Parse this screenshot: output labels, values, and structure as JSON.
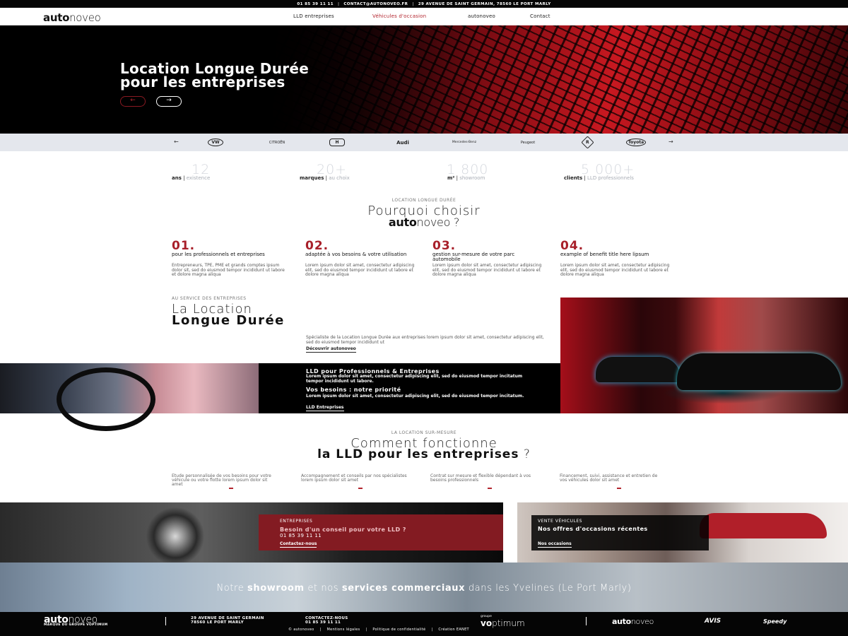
{
  "topbar": {
    "phone": "01 85 39 11 11",
    "email": "CONTACT@AUTONOVEO.FR",
    "address": "29 AVENUE DE SAINT GERMAIN, 78560 LE PORT MARLY"
  },
  "nav": {
    "logo_bold": "auto",
    "logo_light": "noveo",
    "links": [
      "LLD entreprises",
      "Véhicules d'occasion",
      "autonoveo",
      "Contact"
    ],
    "active_index": 1
  },
  "hero": {
    "title_line1": "Location Longue Durée",
    "title_line2": "pour les entreprises",
    "prev_icon": "←",
    "next_icon": "→"
  },
  "brands": {
    "prev_icon": "←",
    "next_icon": "→",
    "items": [
      "VW",
      "CITROËN",
      "H",
      "Audi",
      "Mercedes-Benz",
      "Peugeot",
      "R",
      "Toyota"
    ]
  },
  "stats": [
    {
      "value": "12",
      "label_bold": "ans",
      "label_light": "existence"
    },
    {
      "value": "20+",
      "label_bold": "marques",
      "label_light": "au choix"
    },
    {
      "value": "1 800",
      "label_bold": "m²",
      "label_light": "showroom"
    },
    {
      "value": "5 000+",
      "label_bold": "clients",
      "label_light": "LLD professionnels"
    }
  ],
  "why": {
    "kicker": "LOCATION LONGUE DURÉE",
    "title_line1": "Pourquoi choisir",
    "title_logo_bold": "auto",
    "title_logo_light": "noveo",
    "title_suffix": " ?",
    "features": [
      {
        "num": "01.",
        "title": "pour les professionnels et entreprises",
        "text": "Entrepreneurs, TPE, PME et grands comptes ipsum dolor sit, sed do eiusmod tempor incididunt ut labore et dolore magna aliqua"
      },
      {
        "num": "02.",
        "title": "adaptée à vos besoins & votre utilisation",
        "text": "Lorem ipsum dolor sit amet, consectetur adipiscing elit, sed do eiusmod tempor incididunt ut labore et dolore magna aliqua"
      },
      {
        "num": "03.",
        "title": "gestion sur-mesure de votre parc automobile",
        "text": "Lorem ipsum dolor sit amet, consectetur adipiscing elit, sed do eiusmod tempor incididunt ut labore et dolore magna aliqua"
      },
      {
        "num": "04.",
        "title": "example of benefit title here lipsum",
        "text": "Lorem ipsum dolor sit amet, consectetur adipiscing elit, sed do eiusmod tempor incididunt ut labore et dolore magna aliqua"
      }
    ]
  },
  "lld": {
    "kicker": "AU SERVICE DES ENTREPRISES",
    "title_line1": "La Location",
    "title_line2": "Longue Durée",
    "text": "Spécialiste de la Location Longue Durée aux entreprises lorem ipsum dolor sit amet, consectetur adipiscing elit, sed do eiusmod tempor incididunt ut",
    "link": "Découvrir autonoveo"
  },
  "black_panel": {
    "title1": "LLD pour Professionnels & Entreprises",
    "text1": "Lorem ipsum dolor sit amet, consectetur adipiscing elit, sed do eiusmod tempor incitatum tempor incididunt ut labore.",
    "title2": "Vos besoins : notre priorité",
    "text2": "Lorem ipsum dolor sit amet, consectetur adipiscing elit, sed do eiusmod tempor incitatum.",
    "link": "LLD Entreprises"
  },
  "how": {
    "kicker": "LA LOCATION SUR-MESURE",
    "title_line1": "Comment fonctionne",
    "title_bold": "la LLD pour les entreprises",
    "title_suffix": " ?",
    "steps": [
      "Etude personnalisée de vos besoins pour votre véhicule ou votre flotte lorem ipsum dolor sit amet",
      "Accompagnement et conseils par nos spécialistes lorem ipsum dolor sit amet",
      "Contrat sur mesure et flexible dépendant à vos besoins professionnels",
      "Financement, suivi, assistance et entretien de vos véhicules dolor sit amet"
    ]
  },
  "cards": {
    "left": {
      "kicker": "ENTREPRISES",
      "title": "Besoin d'un conseil pour votre LLD ?",
      "phone": "01 85 39 11 11",
      "link": "Contactez-nous"
    },
    "right": {
      "kicker": "VENTE VÉHICULES",
      "title": "Nos offres d'occasions récentes",
      "link": "Nos occasions"
    }
  },
  "banner": {
    "p1": "Notre ",
    "b1": "showroom",
    "p2": " et nos ",
    "b2": "services commerciaux",
    "p3": " dans les Yvelines (Le Port Marly)"
  },
  "footer": {
    "logo_bold": "auto",
    "logo_light": "noveo",
    "tagline": "MARQUE DU GROUPE VOPTIMUM",
    "address1": "29 AVENUE DE SAINT GERMAIN",
    "address2": "78560 LE PORT MARLY",
    "contact_label": "CONTACTEZ-NOUS",
    "contact_phone": "01 85 39 11 11",
    "group_small": "groupe",
    "group_bold": "vo",
    "group_light": "ptimum",
    "partner1_bold": "auto",
    "partner1_light": "noveo",
    "partner2": "AVIS",
    "partner3": "Speedy",
    "links": [
      "© autonoveo",
      "Mentions légales",
      "Politique de confidentialité",
      "Création EANET"
    ]
  },
  "colors": {
    "accent": "#b3262f",
    "dark": "#050505",
    "brand_bar": "#e4e7ed"
  }
}
